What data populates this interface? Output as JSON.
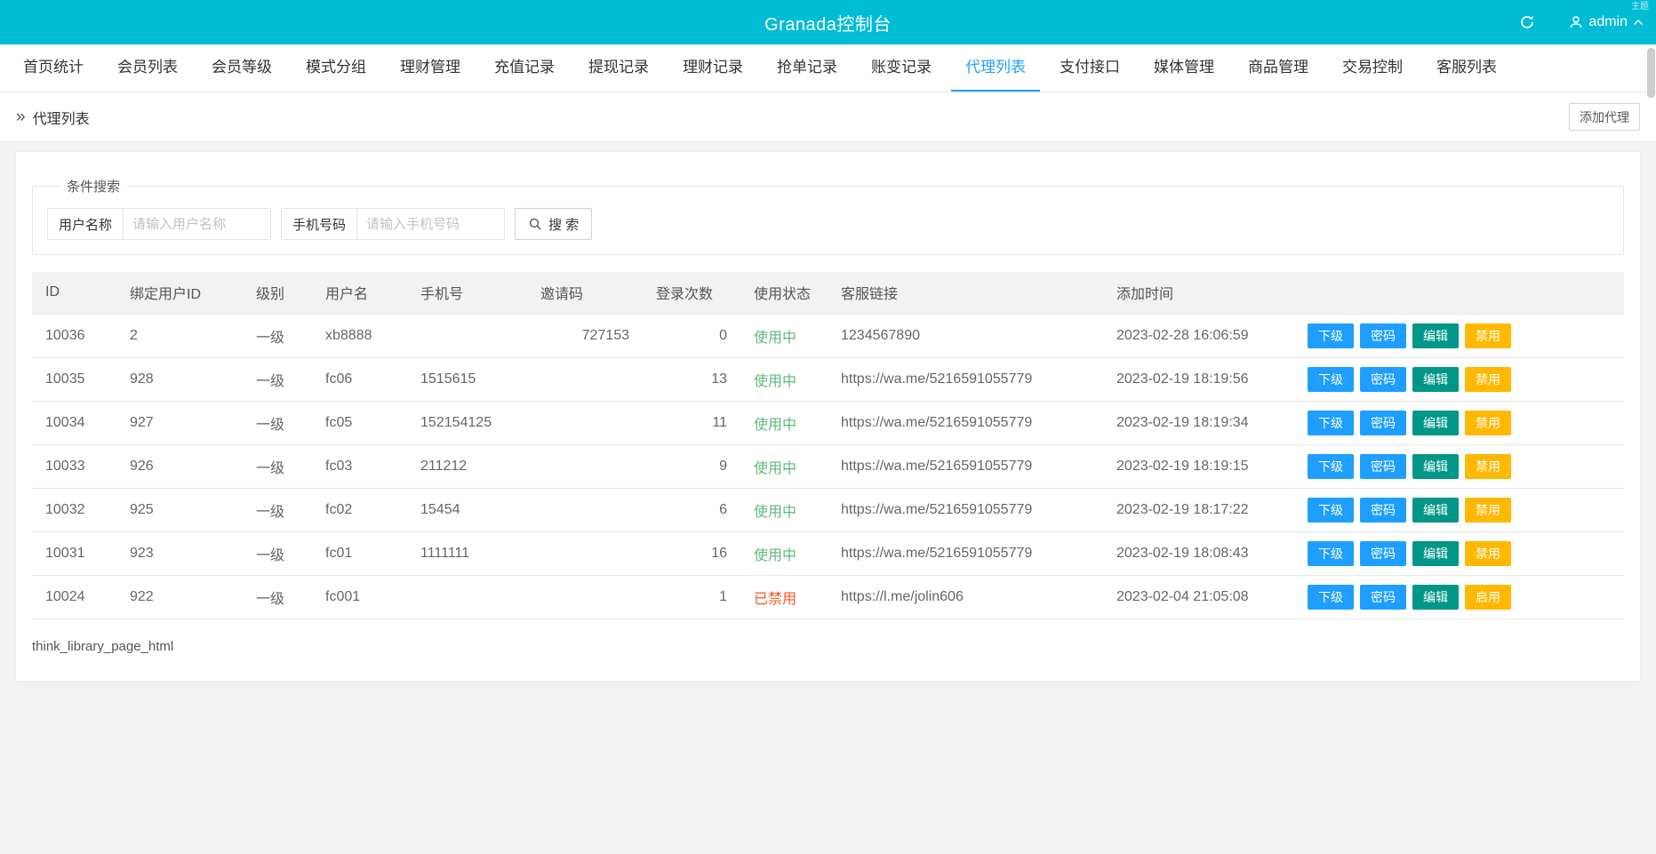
{
  "header": {
    "title": "Granada控制台",
    "user": "admin",
    "corner_text": "主题"
  },
  "nav": {
    "tabs": [
      {
        "label": "首页统计",
        "active": false
      },
      {
        "label": "会员列表",
        "active": false
      },
      {
        "label": "会员等级",
        "active": false
      },
      {
        "label": "模式分组",
        "active": false
      },
      {
        "label": "理财管理",
        "active": false
      },
      {
        "label": "充值记录",
        "active": false
      },
      {
        "label": "提现记录",
        "active": false
      },
      {
        "label": "理财记录",
        "active": false
      },
      {
        "label": "抢单记录",
        "active": false
      },
      {
        "label": "账变记录",
        "active": false
      },
      {
        "label": "代理列表",
        "active": true
      },
      {
        "label": "支付接口",
        "active": false
      },
      {
        "label": "媒体管理",
        "active": false
      },
      {
        "label": "商品管理",
        "active": false
      },
      {
        "label": "交易控制",
        "active": false
      },
      {
        "label": "客服列表",
        "active": false
      }
    ]
  },
  "breadcrumb": {
    "arrow_icon": "»",
    "label": "代理列表",
    "add_button_label": "添加代理"
  },
  "search": {
    "legend": "条件搜索",
    "username_label": "用户名称",
    "username_placeholder": "请输入用户名称",
    "phone_label": "手机号码",
    "phone_placeholder": "请输入手机号码",
    "search_button_label": "搜 索"
  },
  "table": {
    "headers": [
      "ID",
      "绑定用户ID",
      "级别",
      "用户名",
      "手机号",
      "邀请码",
      "登录次数",
      "使用状态",
      "客服链接",
      "添加时间",
      ""
    ],
    "action_labels": {
      "sub": "下级",
      "password": "密码",
      "edit": "编辑"
    },
    "rows": [
      {
        "id": "10036",
        "bind_user_id": "2",
        "level": "一级",
        "username": "xb8888",
        "phone": "",
        "invite_code": "727153",
        "login_count": "0",
        "status": "使用中",
        "status_type": "active",
        "service_link": "1234567890",
        "add_time": "2023-02-28 16:06:59",
        "toggle_label": "禁用"
      },
      {
        "id": "10035",
        "bind_user_id": "928",
        "level": "一级",
        "username": "fc06",
        "phone": "1515615",
        "invite_code": "",
        "login_count": "13",
        "status": "使用中",
        "status_type": "active",
        "service_link": "https://wa.me/5216591055779",
        "add_time": "2023-02-19 18:19:56",
        "toggle_label": "禁用"
      },
      {
        "id": "10034",
        "bind_user_id": "927",
        "level": "一级",
        "username": "fc05",
        "phone": "152154125",
        "invite_code": "",
        "login_count": "11",
        "status": "使用中",
        "status_type": "active",
        "service_link": "https://wa.me/5216591055779",
        "add_time": "2023-02-19 18:19:34",
        "toggle_label": "禁用"
      },
      {
        "id": "10033",
        "bind_user_id": "926",
        "level": "一级",
        "username": "fc03",
        "phone": "211212",
        "invite_code": "",
        "login_count": "9",
        "status": "使用中",
        "status_type": "active",
        "service_link": "https://wa.me/5216591055779",
        "add_time": "2023-02-19 18:19:15",
        "toggle_label": "禁用"
      },
      {
        "id": "10032",
        "bind_user_id": "925",
        "level": "一级",
        "username": "fc02",
        "phone": "15454",
        "invite_code": "",
        "login_count": "6",
        "status": "使用中",
        "status_type": "active",
        "service_link": "https://wa.me/5216591055779",
        "add_time": "2023-02-19 18:17:22",
        "toggle_label": "禁用"
      },
      {
        "id": "10031",
        "bind_user_id": "923",
        "level": "一级",
        "username": "fc01",
        "phone": "1111111",
        "invite_code": "",
        "login_count": "16",
        "status": "使用中",
        "status_type": "active",
        "service_link": "https://wa.me/5216591055779",
        "add_time": "2023-02-19 18:08:43",
        "toggle_label": "禁用"
      },
      {
        "id": "10024",
        "bind_user_id": "922",
        "level": "一级",
        "username": "fc001",
        "phone": "",
        "invite_code": "",
        "login_count": "1",
        "status": "已禁用",
        "status_type": "disabled",
        "service_link": "https://l.me/jolin606",
        "add_time": "2023-02-04 21:05:08",
        "toggle_label": "启用"
      }
    ]
  },
  "footer": {
    "debug_text": "think_library_page_html"
  },
  "colors": {
    "topbar": "#00bcd4",
    "accent_blue": "#1E9FFF",
    "action_green": "#009688",
    "action_yellow": "#FFB800",
    "status_active_green": "#5FB878",
    "status_disabled_red": "#FF5722"
  }
}
